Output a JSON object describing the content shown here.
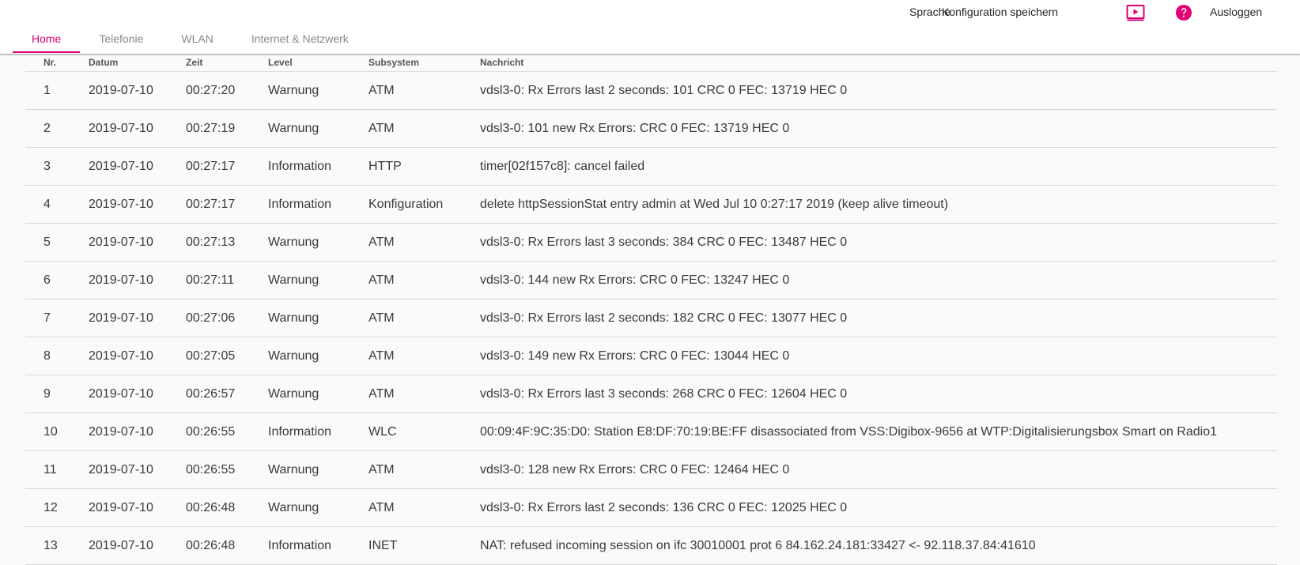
{
  "header": {
    "utility": {
      "language": "Sprache",
      "save_config": "Konfiguration speichern",
      "video_icon": "video-play-icon",
      "help_icon": "help-icon",
      "logout": "Ausloggen"
    },
    "tabs": [
      {
        "label": "Home",
        "active": true
      },
      {
        "label": "Telefonie",
        "active": false
      },
      {
        "label": "WLAN",
        "active": false
      },
      {
        "label": "Internet & Netzwerk",
        "active": false
      }
    ]
  },
  "colors": {
    "accent": "#e20074"
  },
  "log": {
    "columns": [
      "Nr.",
      "Datum",
      "Zeit",
      "Level",
      "Subsystem",
      "Nachricht"
    ],
    "rows": [
      [
        "1",
        "2019-07-10",
        "00:27:20",
        "Warnung",
        "ATM",
        "vdsl3-0: Rx Errors last 2 seconds: 101 CRC 0 FEC: 13719 HEC 0"
      ],
      [
        "2",
        "2019-07-10",
        "00:27:19",
        "Warnung",
        "ATM",
        "vdsl3-0: 101 new Rx Errors: CRC 0 FEC: 13719 HEC 0"
      ],
      [
        "3",
        "2019-07-10",
        "00:27:17",
        "Information",
        "HTTP",
        "timer[02f157c8]: cancel failed"
      ],
      [
        "4",
        "2019-07-10",
        "00:27:17",
        "Information",
        "Konfiguration",
        "delete httpSessionStat entry admin at Wed Jul 10 0:27:17 2019 (keep alive timeout)"
      ],
      [
        "5",
        "2019-07-10",
        "00:27:13",
        "Warnung",
        "ATM",
        "vdsl3-0: Rx Errors last 3 seconds: 384 CRC 0 FEC: 13487 HEC 0"
      ],
      [
        "6",
        "2019-07-10",
        "00:27:11",
        "Warnung",
        "ATM",
        "vdsl3-0: 144 new Rx Errors: CRC 0 FEC: 13247 HEC 0"
      ],
      [
        "7",
        "2019-07-10",
        "00:27:06",
        "Warnung",
        "ATM",
        "vdsl3-0: Rx Errors last 2 seconds: 182 CRC 0 FEC: 13077 HEC 0"
      ],
      [
        "8",
        "2019-07-10",
        "00:27:05",
        "Warnung",
        "ATM",
        "vdsl3-0: 149 new Rx Errors: CRC 0 FEC: 13044 HEC 0"
      ],
      [
        "9",
        "2019-07-10",
        "00:26:57",
        "Warnung",
        "ATM",
        "vdsl3-0: Rx Errors last 3 seconds: 268 CRC 0 FEC: 12604 HEC 0"
      ],
      [
        "10",
        "2019-07-10",
        "00:26:55",
        "Information",
        "WLC",
        "00:09:4F:9C:35:D0: Station E8:DF:70:19:BE:FF disassociated from VSS:Digibox-9656 at WTP:Digitalisierungsbox Smart on Radio1"
      ],
      [
        "11",
        "2019-07-10",
        "00:26:55",
        "Warnung",
        "ATM",
        "vdsl3-0: 128 new Rx Errors: CRC 0 FEC: 12464 HEC 0"
      ],
      [
        "12",
        "2019-07-10",
        "00:26:48",
        "Warnung",
        "ATM",
        "vdsl3-0: Rx Errors last 2 seconds: 136 CRC 0 FEC: 12025 HEC 0"
      ],
      [
        "13",
        "2019-07-10",
        "00:26:48",
        "Information",
        "INET",
        "NAT: refused incoming session on ifc 30010001 prot 6 84.162.24.181:33427 <- 92.118.37.84:41610"
      ]
    ]
  }
}
